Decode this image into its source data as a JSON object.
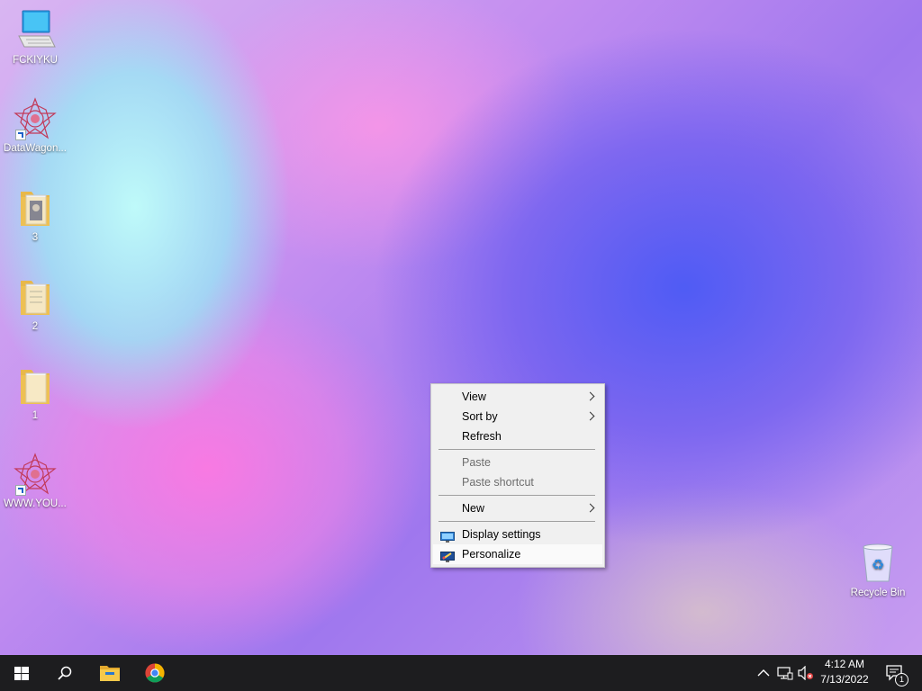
{
  "desktop": {
    "icons": [
      {
        "label": "FCKIYKU"
      },
      {
        "label": "DataWagon..."
      },
      {
        "label": "3"
      },
      {
        "label": "2"
      },
      {
        "label": "1"
      },
      {
        "label": "WWW.YOU..."
      },
      {
        "label": "Recycle Bin"
      }
    ]
  },
  "context_menu": {
    "items": [
      {
        "label": "View",
        "has_submenu": true
      },
      {
        "label": "Sort by",
        "has_submenu": true
      },
      {
        "label": "Refresh"
      },
      {
        "label": "Paste",
        "disabled": true
      },
      {
        "label": "Paste shortcut",
        "disabled": true
      },
      {
        "label": "New",
        "has_submenu": true
      },
      {
        "label": "Display settings",
        "icon": "display-settings-icon"
      },
      {
        "label": "Personalize",
        "icon": "personalize-icon",
        "highlighted": true
      }
    ]
  },
  "taskbar": {
    "pinned": [
      {
        "icon": "windows-start-icon"
      },
      {
        "icon": "search-icon"
      },
      {
        "icon": "file-explorer-icon"
      },
      {
        "icon": "chrome-icon"
      }
    ],
    "tray_icons": [
      "chevron-up-icon",
      "network-icon",
      "volume-muted-icon"
    ],
    "clock": {
      "time": "4:12 AM",
      "date": "7/13/2022"
    },
    "notification_count": "1"
  },
  "colors": {
    "taskbar_bg": "#1d1d1f",
    "menu_bg": "#f0f0f0",
    "accent": "#0078d7"
  }
}
